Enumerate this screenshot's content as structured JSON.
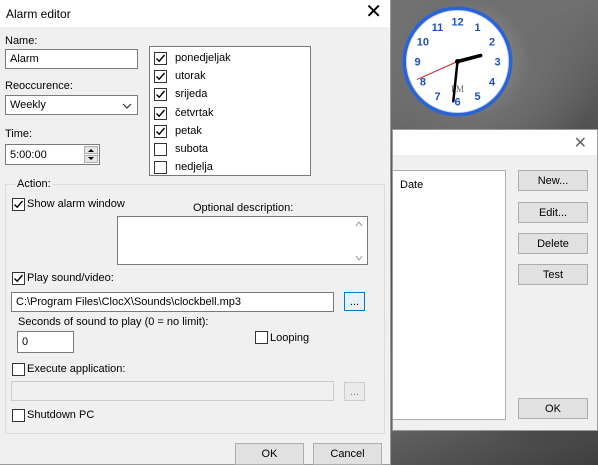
{
  "dialog": {
    "title": "Alarm editor",
    "name_label": "Name:",
    "name_value": "Alarm",
    "recurrence_label": "Reoccurence:",
    "recurrence_value": "Weekly",
    "time_label": "Time:",
    "time_value": "5:00:00",
    "days": [
      {
        "label": "ponedjeljak",
        "checked": true
      },
      {
        "label": "utorak",
        "checked": true
      },
      {
        "label": "srijeda",
        "checked": true
      },
      {
        "label": "četvrtak",
        "checked": true
      },
      {
        "label": "petak",
        "checked": true
      },
      {
        "label": "subota",
        "checked": false
      },
      {
        "label": "nedjelja",
        "checked": false
      }
    ],
    "action_label": "Action:",
    "show_alarm_window_label": "Show alarm window",
    "show_alarm_window_checked": true,
    "optional_description_label": "Optional description:",
    "optional_description_value": "",
    "play_sound_label": "Play sound/video:",
    "play_sound_checked": true,
    "sound_path": "C:\\Program Files\\ClocX\\Sounds\\clockbell.mp3",
    "browse_label": "...",
    "seconds_label": "Seconds of sound to play (0 = no limit):",
    "seconds_value": "0",
    "looping_label": "Looping",
    "looping_checked": false,
    "execute_app_label": "Execute application:",
    "execute_app_checked": false,
    "execute_app_value": "",
    "browse2_label": "...",
    "shutdown_label": "Shutdown PC",
    "shutdown_checked": false,
    "ok_label": "OK",
    "cancel_label": "Cancel"
  },
  "background_window": {
    "list_header": "Date",
    "new_label": "New...",
    "edit_label": "Edit...",
    "delete_label": "Delete",
    "test_label": "Test",
    "ok_label": "OK"
  },
  "clock": {
    "numbers": [
      "12",
      "1",
      "2",
      "3",
      "4",
      "5",
      "6",
      "7",
      "8",
      "9",
      "10",
      "11"
    ],
    "pm_label": "PM",
    "hour": 2,
    "minute": 31,
    "second": 41,
    "face_color": "#ffffff",
    "number_color": "#1f4fc4",
    "rim_color": "#2a63d6"
  },
  "colors": {
    "checkmark": "#000000",
    "browse_border": "#0078d7"
  }
}
